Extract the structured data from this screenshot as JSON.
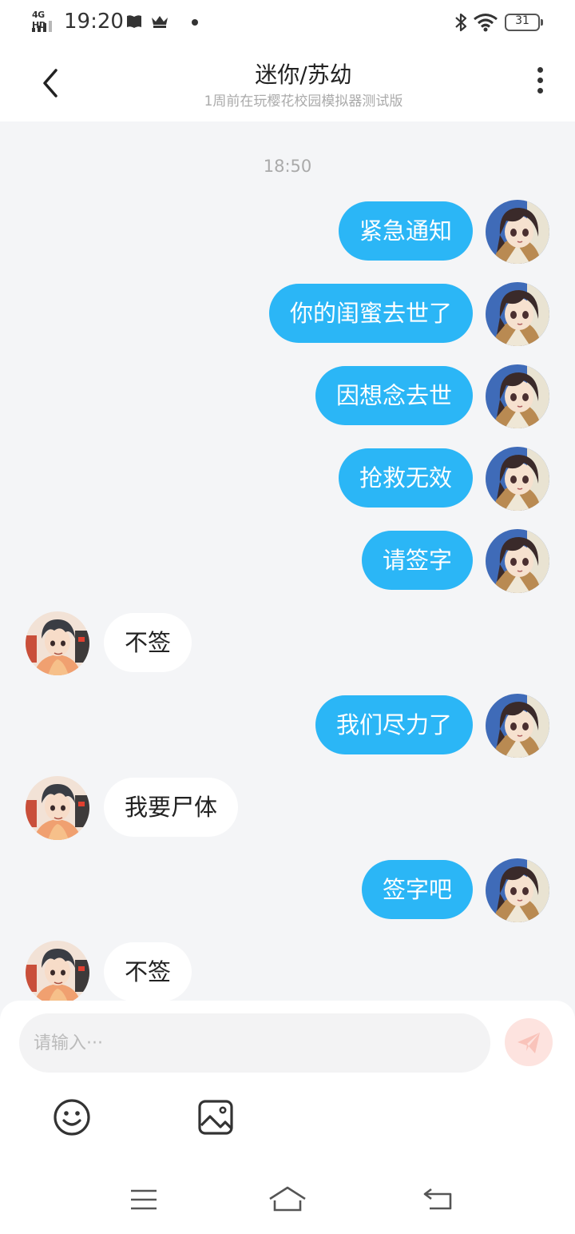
{
  "status_bar": {
    "network": "4G HD",
    "time": "19:20",
    "battery": "31"
  },
  "header": {
    "title": "迷你/苏幼",
    "subtitle": "1周前在玩樱花校园模拟器测试版"
  },
  "chat": {
    "timestamp": "18:50",
    "messages": [
      {
        "side": "out",
        "text": "紧急通知"
      },
      {
        "side": "out",
        "text": "你的闺蜜去世了"
      },
      {
        "side": "out",
        "text": "因想念去世"
      },
      {
        "side": "out",
        "text": "抢救无效"
      },
      {
        "side": "out",
        "text": "请签字"
      },
      {
        "side": "in",
        "text": "不签"
      },
      {
        "side": "out",
        "text": "我们尽力了"
      },
      {
        "side": "in",
        "text": "我要尸体"
      },
      {
        "side": "out",
        "text": "签字吧"
      },
      {
        "side": "in",
        "text": "不签"
      }
    ]
  },
  "composer": {
    "placeholder": "请输入···",
    "value": ""
  },
  "colors": {
    "outgoing_bubble": "#2bb6f6",
    "incoming_bubble": "#ffffff",
    "send_button": "#fde3df",
    "background": "#f4f5f7"
  },
  "icons": {
    "back": "chevron-left-icon",
    "more": "more-vertical-icon",
    "send": "paper-plane-icon",
    "emoji": "smiley-icon",
    "image": "image-icon"
  }
}
